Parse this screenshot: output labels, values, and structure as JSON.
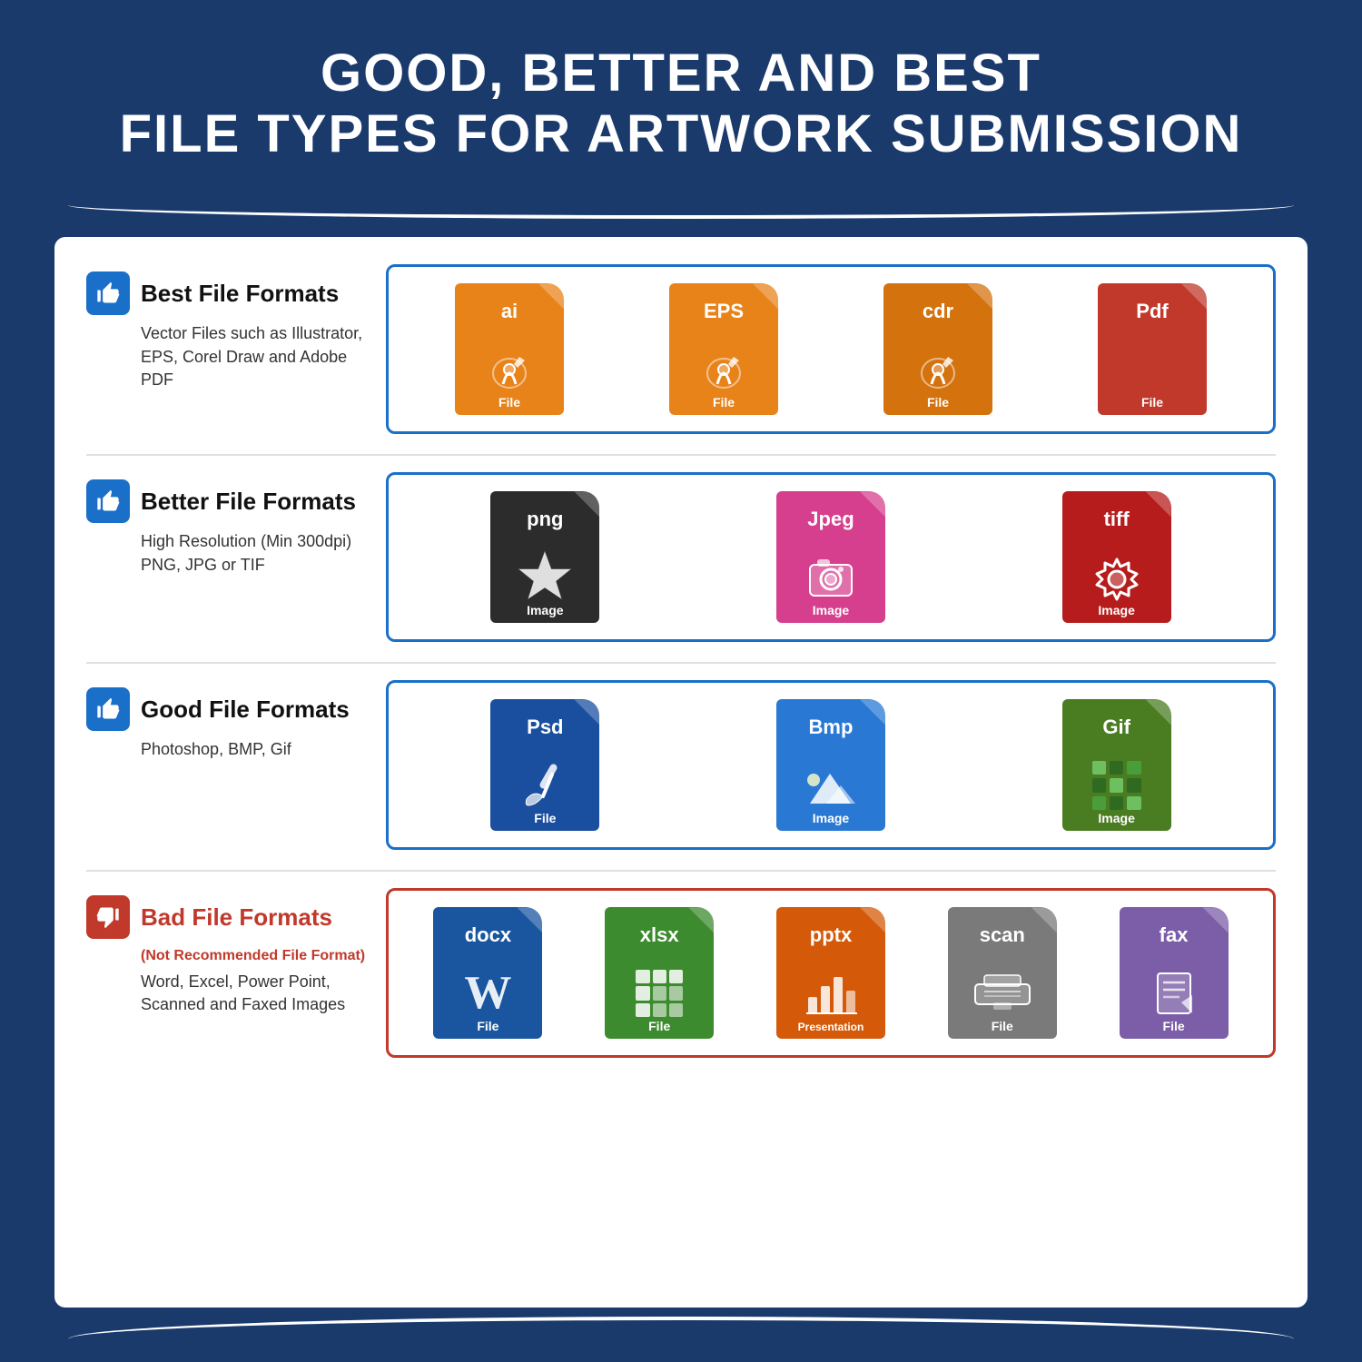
{
  "header": {
    "line1": "GOOD, BETTER AND BEST",
    "line2": "FILE TYPES FOR ARTWORK SUBMISSION"
  },
  "sections": [
    {
      "id": "best",
      "thumbs": "up",
      "title": "Best File Formats",
      "subtitle": "",
      "description": "Vector Files such as Illustrator,\nEPS, Corel Draw and Adobe PDF",
      "border_color": "#1a70c8",
      "files": [
        {
          "ext": "ai",
          "label": "File",
          "color": "orange",
          "icon": "pen"
        },
        {
          "ext": "EPS",
          "label": "File",
          "color": "orange",
          "icon": "pen"
        },
        {
          "ext": "cdr",
          "label": "File",
          "color": "orange-dark",
          "icon": "pen"
        },
        {
          "ext": "Pdf",
          "label": "File",
          "color": "red",
          "icon": "doc"
        }
      ]
    },
    {
      "id": "better",
      "thumbs": "up",
      "title": "Better File Formats",
      "subtitle": "",
      "description": "High Resolution (Min 300dpi)\nPNG, JPG or TIF",
      "border_color": "#1a70c8",
      "files": [
        {
          "ext": "png",
          "label": "Image",
          "color": "black",
          "icon": "star"
        },
        {
          "ext": "Jpeg",
          "label": "Image",
          "color": "pink",
          "icon": "camera"
        },
        {
          "ext": "tiff",
          "label": "Image",
          "color": "tiff-red",
          "icon": "gear"
        }
      ]
    },
    {
      "id": "good",
      "thumbs": "up",
      "title": "Good File Formats",
      "subtitle": "",
      "description": "Photoshop, BMP, Gif",
      "border_color": "#1a70c8",
      "files": [
        {
          "ext": "Psd",
          "label": "File",
          "color": "navy",
          "icon": "brush"
        },
        {
          "ext": "Bmp",
          "label": "Image",
          "color": "blue",
          "icon": "mountain"
        },
        {
          "ext": "Gif",
          "label": "Image",
          "color": "green",
          "icon": "grid"
        }
      ]
    },
    {
      "id": "bad",
      "thumbs": "down",
      "title": "Bad File Formats",
      "subtitle": "(Not Recommended File Format)",
      "description": "Word, Excel, Power Point,\nScanned and Faxed Images",
      "border_color": "#c0392b",
      "files": [
        {
          "ext": "docx",
          "label": "File",
          "color": "doc-blue",
          "icon": "w"
        },
        {
          "ext": "xlsx",
          "label": "File",
          "color": "xls-green",
          "icon": "xgrid"
        },
        {
          "ext": "pptx",
          "label": "Presentation",
          "color": "ppt-orange",
          "icon": "chart"
        },
        {
          "ext": "scan",
          "label": "File",
          "color": "scan-gray",
          "icon": "scanner"
        },
        {
          "ext": "fax",
          "label": "File",
          "color": "fax-purple",
          "icon": "fax"
        }
      ]
    }
  ]
}
